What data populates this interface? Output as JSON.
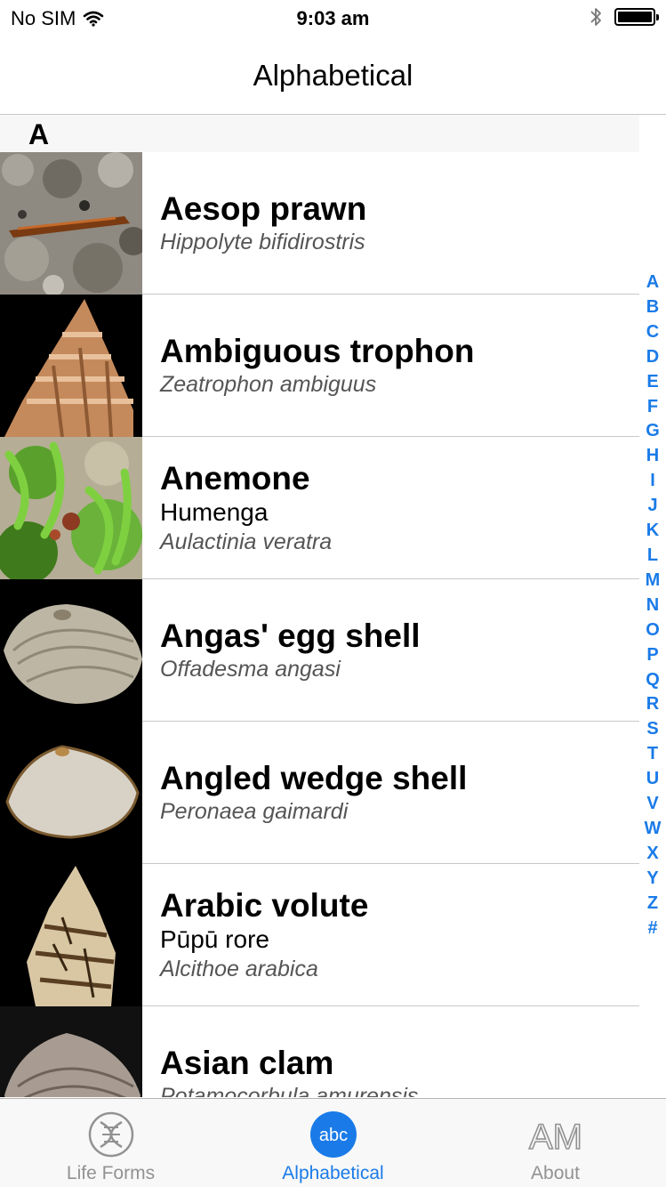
{
  "status": {
    "carrier": "No SIM",
    "time": "9:03 am",
    "battery_level": 1.0
  },
  "nav": {
    "title": "Alphabetical"
  },
  "section": {
    "letter": "A"
  },
  "rows": [
    {
      "common": "Aesop prawn",
      "maori": "",
      "scientific": "Hippolyte bifidirostris"
    },
    {
      "common": "Ambiguous trophon",
      "maori": "",
      "scientific": "Zeatrophon ambiguus"
    },
    {
      "common": "Anemone",
      "maori": "Humenga",
      "scientific": "Aulactinia veratra"
    },
    {
      "common": "Angas' egg shell",
      "maori": "",
      "scientific": "Offadesma angasi"
    },
    {
      "common": "Angled wedge shell",
      "maori": "",
      "scientific": "Peronaea gaimardi"
    },
    {
      "common": "Arabic volute",
      "maori": "Pūpū rore",
      "scientific": "Alcithoe arabica"
    },
    {
      "common": "Asian clam",
      "maori": "",
      "scientific": "Potamocorbula amurensis"
    }
  ],
  "index": [
    "A",
    "B",
    "C",
    "D",
    "E",
    "F",
    "G",
    "H",
    "I",
    "J",
    "K",
    "L",
    "M",
    "N",
    "O",
    "P",
    "Q",
    "R",
    "S",
    "T",
    "U",
    "V",
    "W",
    "X",
    "Y",
    "Z",
    "#"
  ],
  "tabs": [
    {
      "label": "Life Forms",
      "icon": "dna-icon",
      "active": false
    },
    {
      "label": "Alphabetical",
      "icon": "abc-icon",
      "icon_text": "abc",
      "active": true
    },
    {
      "label": "About",
      "icon": "am-logo-icon",
      "icon_text": "AM",
      "active": false
    }
  ],
  "colors": {
    "accent": "#1a7be8",
    "inactive": "#929292"
  }
}
